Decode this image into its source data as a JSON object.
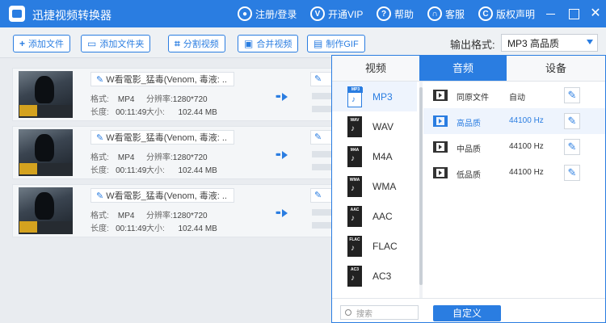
{
  "app": {
    "title": "迅捷视频转换器"
  },
  "titlebar": {
    "login": "注册/登录",
    "vip": "开通VIP",
    "help": "帮助",
    "service": "客服",
    "copyright": "版权声明",
    "close_glyph": "✕"
  },
  "toolbar": {
    "add_file": "添加文件",
    "add_folder": "添加文件夹",
    "split": "分割视频",
    "merge": "合并视频",
    "make_gif": "制作GIF",
    "output_format_label": "输出格式:",
    "output_format_value": "MP3  高品质"
  },
  "files": [
    {
      "name": "W看電影_猛毒(Venom, 毒液: ..",
      "format_k": "格式:",
      "format_v": "MP4",
      "res_k": "分辨率:",
      "res_v": "1280*720",
      "dur_k": "长度:",
      "dur_v": "00:11:49",
      "size_k": "大小:",
      "size_v": "102.44 MB"
    },
    {
      "name": "W看電影_猛毒(Venom, 毒液: ..",
      "format_k": "格式:",
      "format_v": "MP4",
      "res_k": "分辨率:",
      "res_v": "1280*720",
      "dur_k": "长度:",
      "dur_v": "00:11:49",
      "size_k": "大小:",
      "size_v": "102.44 MB"
    },
    {
      "name": "W看電影_猛毒(Venom, 毒液: ..",
      "format_k": "格式:",
      "format_v": "MP4",
      "res_k": "分辨率:",
      "res_v": "1280*720",
      "dur_k": "长度:",
      "dur_v": "00:11:49",
      "size_k": "大小:",
      "size_v": "102.44 MB"
    }
  ],
  "popup": {
    "tabs": [
      "视频",
      "音频",
      "设备"
    ],
    "active_tab": "音频",
    "formats": [
      "MP3",
      "WAV",
      "M4A",
      "WMA",
      "AAC",
      "FLAC",
      "AC3"
    ],
    "selected_format": "MP3",
    "qualities": [
      {
        "name": "同原文件",
        "rate": "自动"
      },
      {
        "name": "高品质",
        "rate": "44100 Hz"
      },
      {
        "name": "中品质",
        "rate": "44100 Hz"
      },
      {
        "name": "低品质",
        "rate": "44100 Hz"
      }
    ],
    "selected_quality": "高品质",
    "search_placeholder": "搜索",
    "custom_button": "自定义"
  },
  "colors": {
    "accent": "#2a7de1",
    "selected_bg": "#eef4fd"
  }
}
